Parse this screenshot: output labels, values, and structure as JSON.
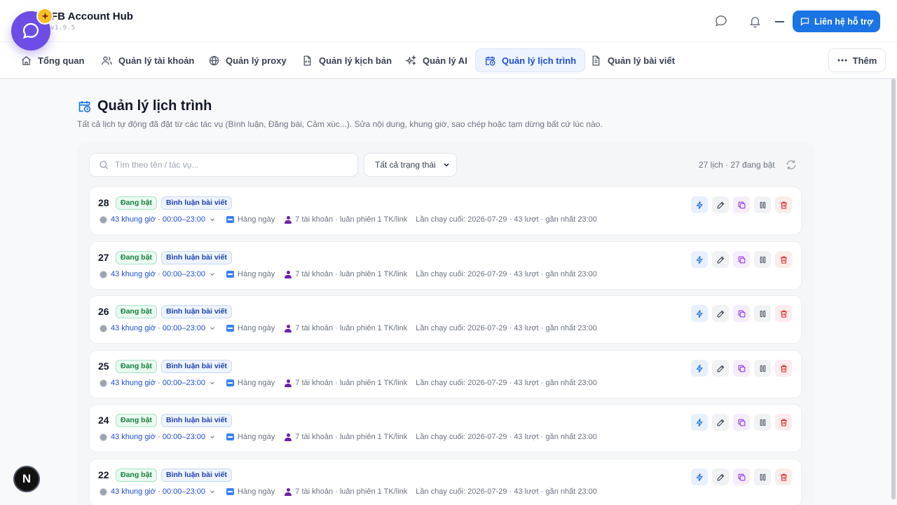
{
  "header": {
    "app_title": "FB Account Hub",
    "version": "v1.9.5",
    "support_label": "Liên hệ hỗ trợ"
  },
  "nav": {
    "items": [
      {
        "label": "Tổng quan",
        "icon": "home-icon"
      },
      {
        "label": "Quản lý tài khoản",
        "icon": "users-icon"
      },
      {
        "label": "Quản lý proxy",
        "icon": "globe-icon"
      },
      {
        "label": "Quản lý kịch bản",
        "icon": "script-file-icon"
      },
      {
        "label": "Quản lý AI",
        "icon": "sparkles-icon"
      },
      {
        "label": "Quản lý lịch trình",
        "icon": "calendar-clock-icon",
        "active": true
      },
      {
        "label": "Quản lý bài viết",
        "icon": "document-icon"
      }
    ],
    "more_label": "Thêm"
  },
  "page": {
    "title": "Quản lý lịch trình",
    "description": "Tất cả lịch tự động đã đặt từ các tác vụ (Bình luận, Đăng bài, Cảm xúc...). Sửa nội dung, khung giờ, sao chép hoặc tạm dừng bất cứ lúc nào."
  },
  "filters": {
    "search_placeholder": "Tìm theo tên / tác vụ...",
    "status_selected": "Tất cả trạng thái",
    "count_text": "27 lịch · 27 đang bật"
  },
  "schedules": [
    {
      "id": "28",
      "status": "Đang bật",
      "type": "Bình luận bài viết",
      "slots": "43 khung giờ · 00:00–23:00",
      "frequency": "Hàng ngày",
      "accounts": "7 tài khoản · luân phiên 1 TK/link",
      "last_run": "Lần chạy cuối: 2026-07-29 · 43 lượt · gần nhất 23:00"
    },
    {
      "id": "27",
      "status": "Đang bật",
      "type": "Bình luận bài viết",
      "slots": "43 khung giờ · 00:00–23:00",
      "frequency": "Hàng ngày",
      "accounts": "7 tài khoản · luân phiên 1 TK/link",
      "last_run": "Lần chạy cuối: 2026-07-29 · 43 lượt · gần nhất 23:00"
    },
    {
      "id": "26",
      "status": "Đang bật",
      "type": "Bình luận bài viết",
      "slots": "43 khung giờ · 00:00–23:00",
      "frequency": "Hàng ngày",
      "accounts": "7 tài khoản · luân phiên 1 TK/link",
      "last_run": "Lần chạy cuối: 2026-07-29 · 43 lượt · gần nhất 23:00"
    },
    {
      "id": "25",
      "status": "Đang bật",
      "type": "Bình luận bài viết",
      "slots": "43 khung giờ · 00:00–23:00",
      "frequency": "Hàng ngày",
      "accounts": "7 tài khoản · luân phiên 1 TK/link",
      "last_run": "Lần chạy cuối: 2026-07-29 · 43 lượt · gần nhất 23:00"
    },
    {
      "id": "24",
      "status": "Đang bật",
      "type": "Bình luận bài viết",
      "slots": "43 khung giờ · 00:00–23:00",
      "frequency": "Hàng ngày",
      "accounts": "7 tài khoản · luân phiên 1 TK/link",
      "last_run": "Lần chạy cuối: 2026-07-29 · 43 lượt · gần nhất 23:00"
    },
    {
      "id": "22",
      "status": "Đang bật",
      "type": "Bình luận bài viết",
      "slots": "43 khung giờ · 00:00–23:00",
      "frequency": "Hàng ngày",
      "accounts": "7 tài khoản · luân phiên 1 TK/link",
      "last_run": "Lần chạy cuối: 2026-07-29 · 43 lượt · gần nhất 23:00"
    }
  ],
  "floating": {
    "dev_badge": "N"
  },
  "colors": {
    "primary": "#1b74e4",
    "logo_purple": "#6d4de6",
    "active_nav_bg": "#eef4ff",
    "status_green": "#15803d",
    "delete_red": "#dc2626"
  }
}
